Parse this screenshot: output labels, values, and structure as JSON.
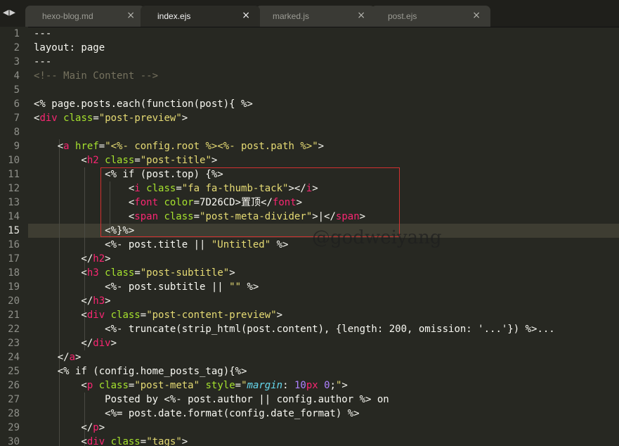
{
  "nav": {
    "back": "◀",
    "forward": "▶"
  },
  "tabs": [
    {
      "label": "hexo-blog.md",
      "active": false,
      "close": "×"
    },
    {
      "label": "index.ejs",
      "active": true,
      "close": "×"
    },
    {
      "label": "marked.js",
      "active": false,
      "close": "×"
    },
    {
      "label": "post.ejs",
      "active": false,
      "close": "×"
    }
  ],
  "editor": {
    "current_line": 15,
    "watermark": "@godweiyang",
    "lines": [
      {
        "n": "1",
        "tokens": [
          [
            "p",
            "---"
          ]
        ]
      },
      {
        "n": "2",
        "tokens": [
          [
            "p",
            "layout: page"
          ]
        ]
      },
      {
        "n": "3",
        "tokens": [
          [
            "p",
            "---"
          ]
        ]
      },
      {
        "n": "4",
        "tokens": [
          [
            "c",
            "<!-- Main Content -->"
          ]
        ]
      },
      {
        "n": "5",
        "tokens": []
      },
      {
        "n": "6",
        "tokens": [
          [
            "p",
            "<% page.posts.each(function(post){ %>"
          ]
        ]
      },
      {
        "n": "7",
        "tokens": [
          [
            "p",
            "<"
          ],
          [
            "tag",
            "div"
          ],
          [
            "p",
            " "
          ],
          [
            "attr",
            "class"
          ],
          [
            "p",
            "="
          ],
          [
            "str",
            "\"post-preview\""
          ],
          [
            "p",
            ">"
          ]
        ]
      },
      {
        "n": "8",
        "tokens": []
      },
      {
        "n": "9",
        "tokens": [
          [
            "p",
            "    <"
          ],
          [
            "tag",
            "a"
          ],
          [
            "p",
            " "
          ],
          [
            "attr",
            "href"
          ],
          [
            "p",
            "="
          ],
          [
            "str",
            "\"<%- config.root %><%- post.path %>\""
          ],
          [
            "p",
            ">"
          ]
        ]
      },
      {
        "n": "10",
        "tokens": [
          [
            "p",
            "        <"
          ],
          [
            "tag",
            "h2"
          ],
          [
            "p",
            " "
          ],
          [
            "attr",
            "class"
          ],
          [
            "p",
            "="
          ],
          [
            "str",
            "\"post-title\""
          ],
          [
            "p",
            ">"
          ]
        ]
      },
      {
        "n": "11",
        "tokens": [
          [
            "p",
            "            <% if (post.top) {%>"
          ]
        ]
      },
      {
        "n": "12",
        "tokens": [
          [
            "p",
            "                <"
          ],
          [
            "tag",
            "i"
          ],
          [
            "p",
            " "
          ],
          [
            "attr",
            "class"
          ],
          [
            "p",
            "="
          ],
          [
            "str",
            "\"fa fa-thumb-tack\""
          ],
          [
            "p",
            "></"
          ],
          [
            "tag",
            "i"
          ],
          [
            "p",
            ">"
          ]
        ]
      },
      {
        "n": "13",
        "tokens": [
          [
            "p",
            "                <"
          ],
          [
            "tag",
            "font"
          ],
          [
            "p",
            " "
          ],
          [
            "attr",
            "color"
          ],
          [
            "p",
            "=7D26CD>置顶</"
          ],
          [
            "tag",
            "font"
          ],
          [
            "p",
            ">"
          ]
        ]
      },
      {
        "n": "14",
        "tokens": [
          [
            "p",
            "                <"
          ],
          [
            "tag",
            "span"
          ],
          [
            "p",
            " "
          ],
          [
            "attr",
            "class"
          ],
          [
            "p",
            "="
          ],
          [
            "str",
            "\"post-meta-divider\""
          ],
          [
            "p",
            ">|</"
          ],
          [
            "tag",
            "span"
          ],
          [
            "p",
            ">"
          ]
        ]
      },
      {
        "n": "15",
        "tokens": [
          [
            "p",
            "            <%}%>"
          ]
        ]
      },
      {
        "n": "16",
        "tokens": [
          [
            "p",
            "            <%- post.title || "
          ],
          [
            "str",
            "\"Untitled\""
          ],
          [
            "p",
            " %>"
          ]
        ]
      },
      {
        "n": "17",
        "tokens": [
          [
            "p",
            "        </"
          ],
          [
            "tag",
            "h2"
          ],
          [
            "p",
            ">"
          ]
        ]
      },
      {
        "n": "18",
        "tokens": [
          [
            "p",
            "        <"
          ],
          [
            "tag",
            "h3"
          ],
          [
            "p",
            " "
          ],
          [
            "attr",
            "class"
          ],
          [
            "p",
            "="
          ],
          [
            "str",
            "\"post-subtitle\""
          ],
          [
            "p",
            ">"
          ]
        ]
      },
      {
        "n": "19",
        "tokens": [
          [
            "p",
            "            <%- post.subtitle || "
          ],
          [
            "str",
            "\"\""
          ],
          [
            "p",
            " %>"
          ]
        ]
      },
      {
        "n": "20",
        "tokens": [
          [
            "p",
            "        </"
          ],
          [
            "tag",
            "h3"
          ],
          [
            "p",
            ">"
          ]
        ]
      },
      {
        "n": "21",
        "tokens": [
          [
            "p",
            "        <"
          ],
          [
            "tag",
            "div"
          ],
          [
            "p",
            " "
          ],
          [
            "attr",
            "class"
          ],
          [
            "p",
            "="
          ],
          [
            "str",
            "\"post-content-preview\""
          ],
          [
            "p",
            ">"
          ]
        ]
      },
      {
        "n": "22",
        "tokens": [
          [
            "p",
            "            <%- truncate(strip_html(post.content), {length: 200, omission: '...'}) %>..."
          ]
        ]
      },
      {
        "n": "23",
        "tokens": [
          [
            "p",
            "        </"
          ],
          [
            "tag",
            "div"
          ],
          [
            "p",
            ">"
          ]
        ]
      },
      {
        "n": "24",
        "tokens": [
          [
            "p",
            "    </"
          ],
          [
            "tag",
            "a"
          ],
          [
            "p",
            ">"
          ]
        ]
      },
      {
        "n": "25",
        "tokens": [
          [
            "p",
            "    <% if (config.home_posts_tag){%>"
          ]
        ]
      },
      {
        "n": "26",
        "tokens": [
          [
            "p",
            "        <"
          ],
          [
            "tag",
            "p"
          ],
          [
            "p",
            " "
          ],
          [
            "attr",
            "class"
          ],
          [
            "p",
            "="
          ],
          [
            "str",
            "\"post-meta\""
          ],
          [
            "p",
            " "
          ],
          [
            "attr",
            "style"
          ],
          [
            "p",
            "="
          ],
          [
            "str",
            "\""
          ],
          [
            "ital",
            "margin"
          ],
          [
            "p",
            ": "
          ],
          [
            "num",
            "10"
          ],
          [
            "tag",
            "px"
          ],
          [
            "p",
            " "
          ],
          [
            "num",
            "0"
          ],
          [
            "p",
            ";"
          ],
          [
            "str",
            "\""
          ],
          [
            "p",
            ">"
          ]
        ]
      },
      {
        "n": "27",
        "tokens": [
          [
            "p",
            "            Posted by <%- post.author || config.author %> on"
          ]
        ]
      },
      {
        "n": "28",
        "tokens": [
          [
            "p",
            "            <%= post.date.format(config.date_format) %>"
          ]
        ]
      },
      {
        "n": "29",
        "tokens": [
          [
            "p",
            "        </"
          ],
          [
            "tag",
            "p"
          ],
          [
            "p",
            ">"
          ]
        ]
      },
      {
        "n": "30",
        "tokens": [
          [
            "p",
            "        <"
          ],
          [
            "tag",
            "div"
          ],
          [
            "p",
            " "
          ],
          [
            "attr",
            "class"
          ],
          [
            "p",
            "="
          ],
          [
            "str",
            "\"tags\""
          ],
          [
            "p",
            ">"
          ]
        ]
      }
    ]
  }
}
